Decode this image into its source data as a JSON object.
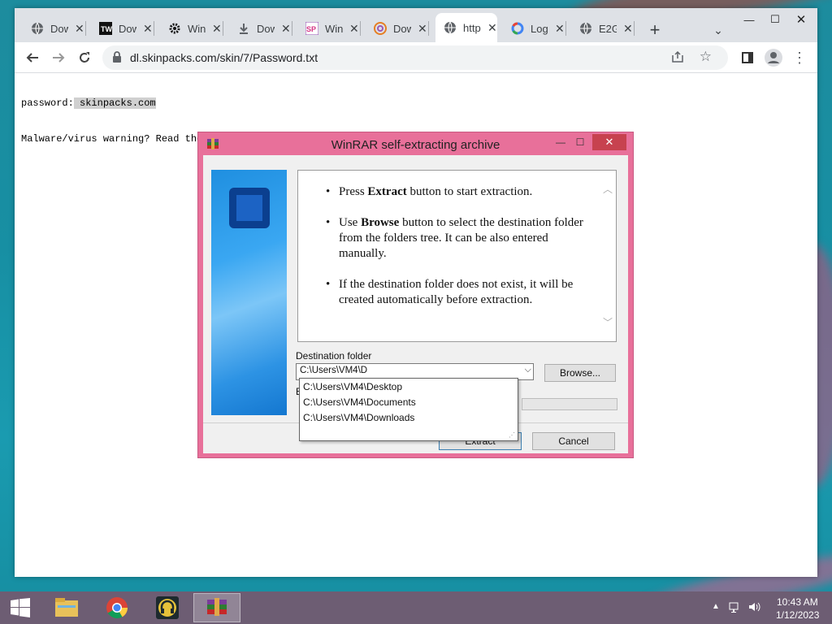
{
  "browser": {
    "tabs": [
      {
        "title": "Dow",
        "icon": "globe-icon"
      },
      {
        "title": "Dow",
        "icon": "tw-icon"
      },
      {
        "title": "Win",
        "icon": "gear-icon"
      },
      {
        "title": "Dow",
        "icon": "download-icon"
      },
      {
        "title": "Win",
        "icon": "sp-icon"
      },
      {
        "title": "Dow",
        "icon": "spiral-icon"
      },
      {
        "title": "http",
        "icon": "globe-icon"
      },
      {
        "title": "Log",
        "icon": "google-icon"
      },
      {
        "title": "E2G",
        "icon": "globe-icon"
      }
    ],
    "url": "dl.skinpacks.com/skin/7/Password.txt",
    "content": {
      "line1_label": "password:",
      "line1_value": " skinpacks.com",
      "line2": "Malware/virus warning? Read the"
    }
  },
  "dialog": {
    "title": "WinRAR self-extracting archive",
    "instructions": [
      {
        "pre": "Press ",
        "bold": "Extract",
        "post": " button to start extraction."
      },
      {
        "pre": "Use ",
        "bold": "Browse",
        "post": " button to select the destination folder from the folders tree. It can be also entered manually."
      },
      {
        "pre": "",
        "bold": "",
        "post": "If the destination folder does not exist, it will be created automatically before extraction."
      }
    ],
    "dest_label": "Destination folder",
    "dest_value": "C:\\Users\\VM4\\D",
    "browse_label": "Browse...",
    "extract_label": "Extract",
    "cancel_label": "Cancel",
    "hidden_label_fragment": "E",
    "suggestions": [
      "C:\\Users\\VM4\\Desktop",
      "C:\\Users\\VM4\\Documents",
      "C:\\Users\\VM4\\Downloads"
    ]
  },
  "taskbar": {
    "time": "10:43 AM",
    "date": "1/12/2023"
  },
  "colors": {
    "dialog_frame": "#e8709a",
    "taskbar": "#6d5d73",
    "desktop": "#1a9bb0"
  }
}
